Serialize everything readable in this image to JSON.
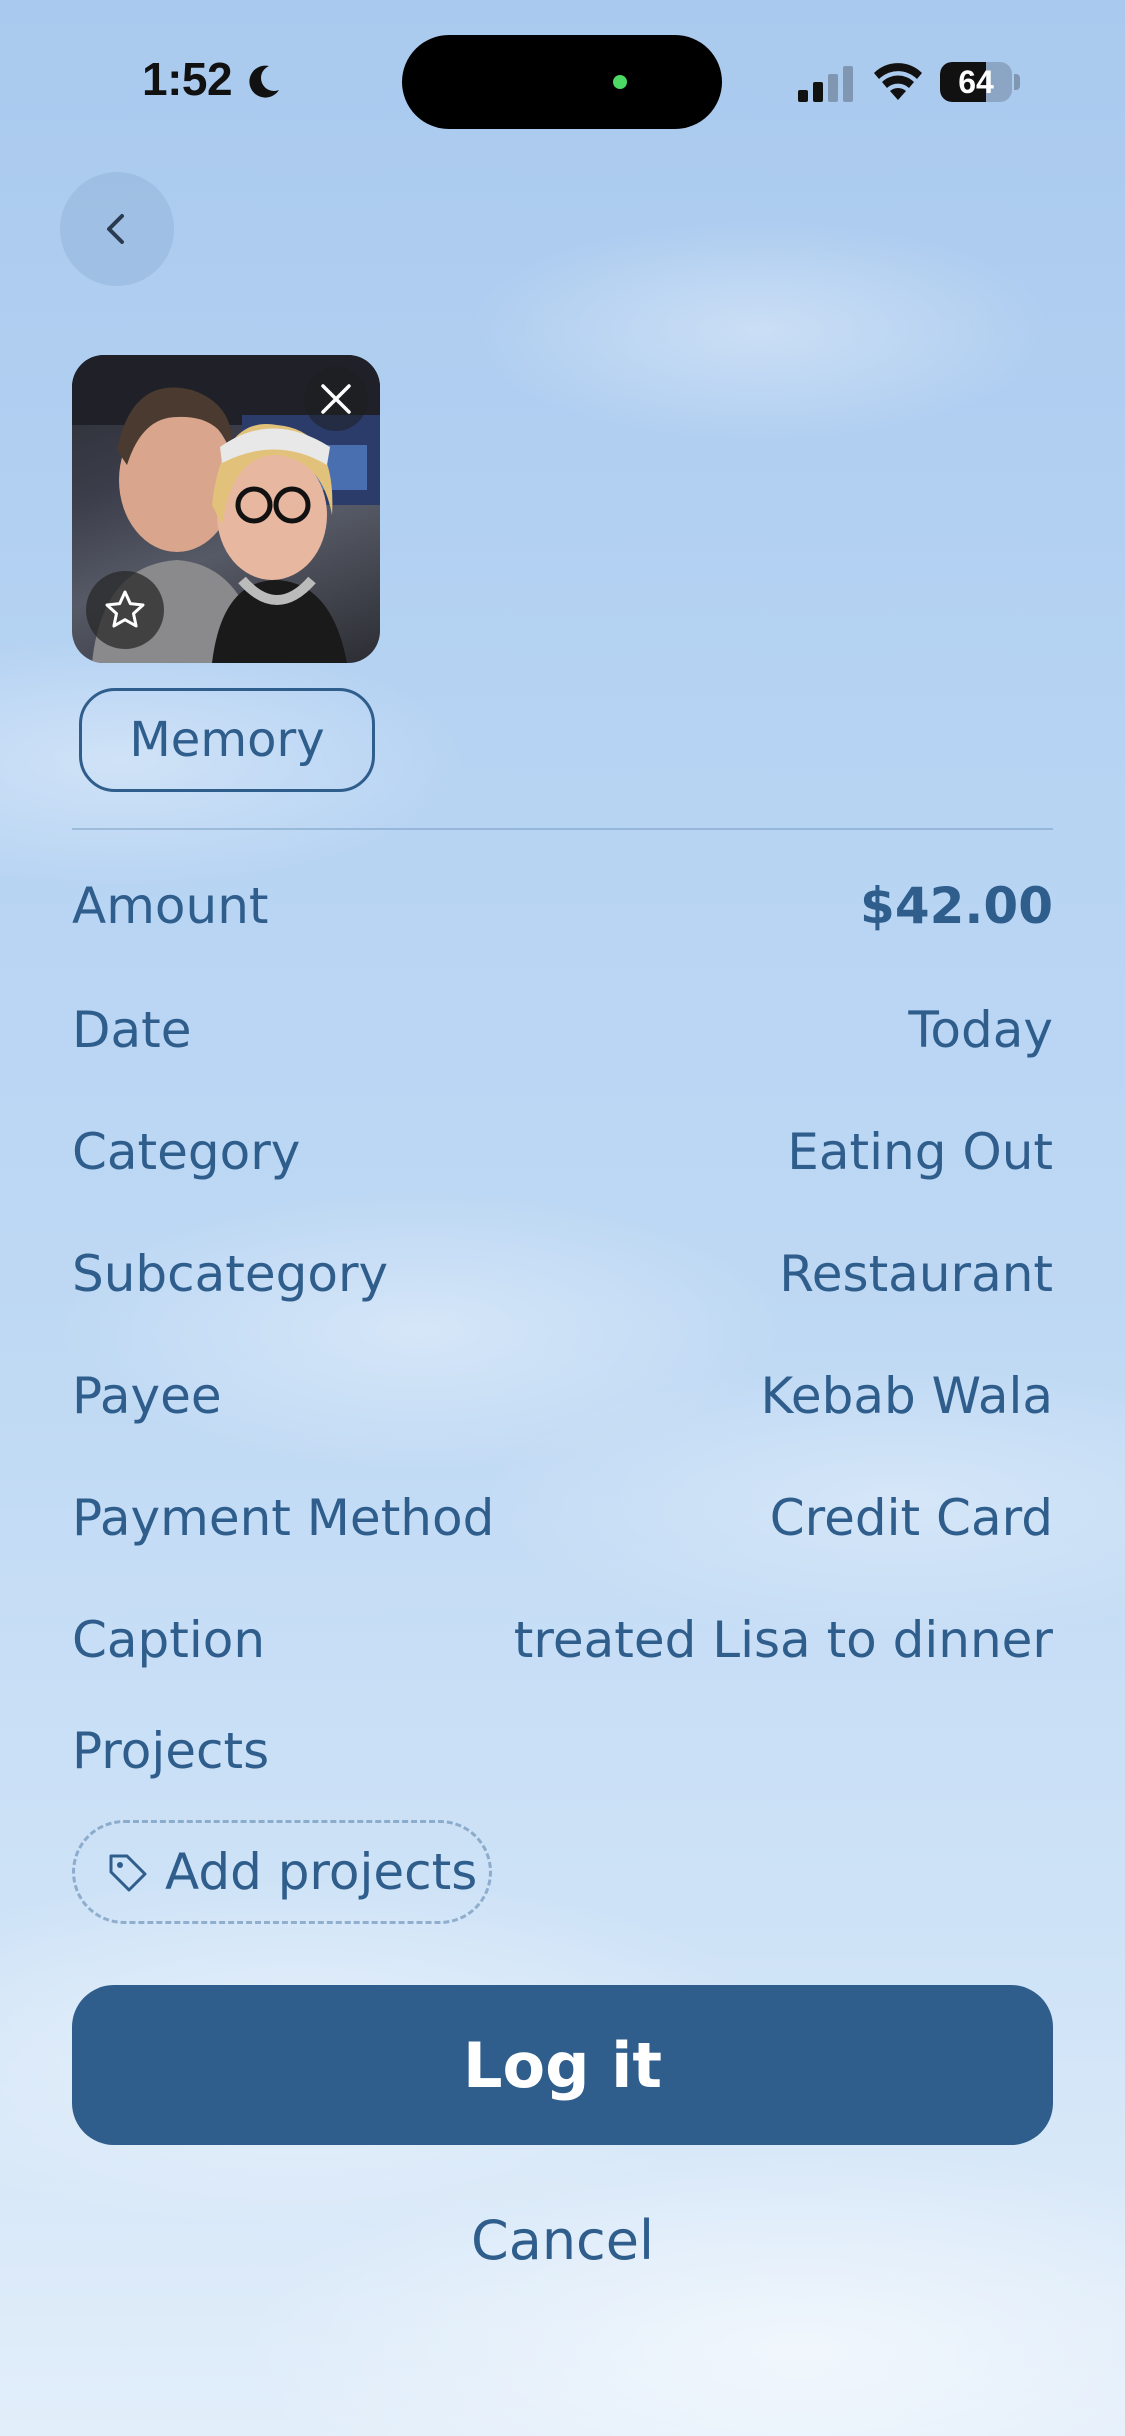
{
  "status_bar": {
    "time": "1:52",
    "battery": "64",
    "battery_fraction": 0.64
  },
  "photo": {
    "description_icon": "photo-thumbnail"
  },
  "tag": {
    "label": "Memory"
  },
  "details": [
    {
      "label": "Amount",
      "value": "$42.00"
    },
    {
      "label": "Date",
      "value": "Today"
    },
    {
      "label": "Category",
      "value": "Eating Out"
    },
    {
      "label": "Subcategory",
      "value": "Restaurant"
    },
    {
      "label": "Payee",
      "value": "Kebab Wala"
    },
    {
      "label": "Payment Method",
      "value": "Credit Card"
    },
    {
      "label": "Caption",
      "value": "treated Lisa to dinner"
    }
  ],
  "projects": {
    "label": "Projects",
    "add_label": "Add projects"
  },
  "actions": {
    "primary": "Log it",
    "secondary": "Cancel"
  },
  "colors": {
    "accent": "#2f5e8c"
  }
}
